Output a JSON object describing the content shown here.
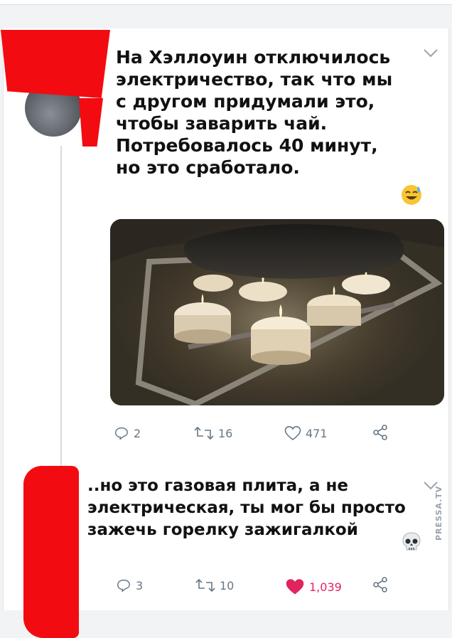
{
  "tweets": [
    {
      "text": "На Хэллоуин отключилось\nэлектричество, так что мы\nс другом придумали это,\nчтобы заварить чай.\nПотребовалось 40 минут,\nно это сработало.",
      "emoji": "sweat-smile-emoji",
      "has_photo": true,
      "photo_description_icon": "candles-under-kettle-photo",
      "stats": {
        "replies": "2",
        "retweets": "16",
        "likes": "471"
      },
      "liked": false
    },
    {
      "text": "..но это газовая плита, а не\nэлектрическая, ты мог бы просто\nзажечь горелку зажигалкой",
      "emoji": "skull-emoji",
      "has_photo": false,
      "stats": {
        "replies": "3",
        "retweets": "10",
        "likes": "1,039"
      },
      "liked": true
    }
  ],
  "colors": {
    "redaction": "#f20c12",
    "like_active": "#e0245e",
    "icon_gray": "#657786"
  },
  "watermark": "PRESSA.TV"
}
